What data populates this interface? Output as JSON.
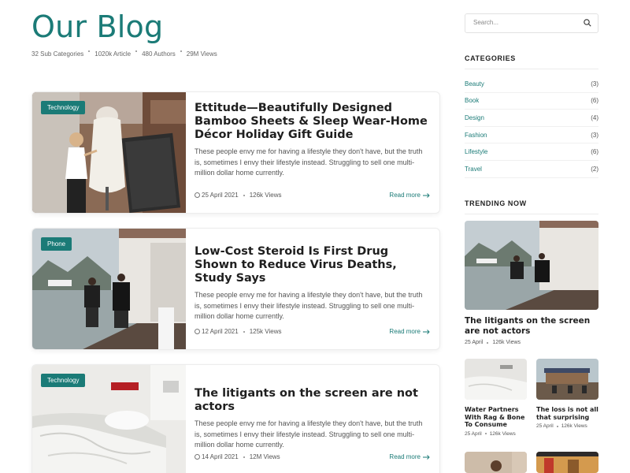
{
  "header": {
    "title": "Our Blog",
    "stats": [
      "32 Sub Categories",
      "1020k Article",
      "480 Authors",
      "29M Views"
    ]
  },
  "posts": [
    {
      "category": "Technology",
      "title": "Ettitude—Beautifully Designed Bamboo Sheets & Sleep Wear-Home Décor Holiday Gift Guide",
      "excerpt": "These people envy me for having a lifestyle they don't have, but the truth is, sometimes I envy their lifestyle instead. Struggling to sell one multi-million dollar home currently.",
      "date": "25 April 2021",
      "views": "126k Views",
      "more": "Read more"
    },
    {
      "category": "Phone",
      "title": "Low-Cost Steroid Is First Drug Shown to Reduce Virus Deaths, Study Says",
      "excerpt": "These people envy me for having a lifestyle they don't have, but the truth is, sometimes I envy their lifestyle instead. Struggling to sell one multi-million dollar home currently.",
      "date": "12 April 2021",
      "views": "125k Views",
      "more": "Read more"
    },
    {
      "category": "Technology",
      "title": "The litigants on the screen are not actors",
      "excerpt": "These people envy me for having a lifestyle they don't have, but the truth is, sometimes I envy their lifestyle instead. Struggling to sell one multi-million dollar home currently.",
      "date": "14 April 2021",
      "views": "12M Views",
      "more": "Read more"
    }
  ],
  "sidebar": {
    "search_placeholder": "Search...",
    "categories_heading": "CATEGORIES",
    "categories": [
      {
        "name": "Beauty",
        "count": "(3)"
      },
      {
        "name": "Book",
        "count": "(6)"
      },
      {
        "name": "Design",
        "count": "(4)"
      },
      {
        "name": "Fashion",
        "count": "(3)"
      },
      {
        "name": "Lifestyle",
        "count": "(6)"
      },
      {
        "name": "Travel",
        "count": "(2)"
      }
    ],
    "trending_heading": "TRENDING NOW",
    "trending_main": {
      "title": "The litigants on the screen are not actors",
      "date": "25 April",
      "views": "126k Views"
    },
    "trending_small": [
      {
        "title": "Water Partners With Rag & Bone To Consume",
        "date": "25 April",
        "views": "126k Views"
      },
      {
        "title": "The loss is not all that surprising",
        "date": "25 April",
        "views": "126k Views"
      }
    ]
  },
  "colors": {
    "accent": "#1b7b77",
    "heading": "#1f1f1f",
    "text": "#555555"
  }
}
